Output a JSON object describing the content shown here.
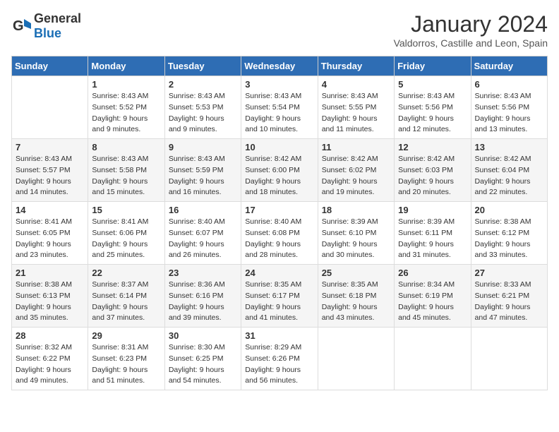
{
  "header": {
    "logo_general": "General",
    "logo_blue": "Blue",
    "month": "January 2024",
    "location": "Valdorros, Castille and Leon, Spain"
  },
  "days_of_week": [
    "Sunday",
    "Monday",
    "Tuesday",
    "Wednesday",
    "Thursday",
    "Friday",
    "Saturday"
  ],
  "weeks": [
    [
      {
        "day": "",
        "info": ""
      },
      {
        "day": "1",
        "info": "Sunrise: 8:43 AM\nSunset: 5:52 PM\nDaylight: 9 hours\nand 9 minutes."
      },
      {
        "day": "2",
        "info": "Sunrise: 8:43 AM\nSunset: 5:53 PM\nDaylight: 9 hours\nand 9 minutes."
      },
      {
        "day": "3",
        "info": "Sunrise: 8:43 AM\nSunset: 5:54 PM\nDaylight: 9 hours\nand 10 minutes."
      },
      {
        "day": "4",
        "info": "Sunrise: 8:43 AM\nSunset: 5:55 PM\nDaylight: 9 hours\nand 11 minutes."
      },
      {
        "day": "5",
        "info": "Sunrise: 8:43 AM\nSunset: 5:56 PM\nDaylight: 9 hours\nand 12 minutes."
      },
      {
        "day": "6",
        "info": "Sunrise: 8:43 AM\nSunset: 5:56 PM\nDaylight: 9 hours\nand 13 minutes."
      }
    ],
    [
      {
        "day": "7",
        "info": "Sunrise: 8:43 AM\nSunset: 5:57 PM\nDaylight: 9 hours\nand 14 minutes."
      },
      {
        "day": "8",
        "info": "Sunrise: 8:43 AM\nSunset: 5:58 PM\nDaylight: 9 hours\nand 15 minutes."
      },
      {
        "day": "9",
        "info": "Sunrise: 8:43 AM\nSunset: 5:59 PM\nDaylight: 9 hours\nand 16 minutes."
      },
      {
        "day": "10",
        "info": "Sunrise: 8:42 AM\nSunset: 6:00 PM\nDaylight: 9 hours\nand 18 minutes."
      },
      {
        "day": "11",
        "info": "Sunrise: 8:42 AM\nSunset: 6:02 PM\nDaylight: 9 hours\nand 19 minutes."
      },
      {
        "day": "12",
        "info": "Sunrise: 8:42 AM\nSunset: 6:03 PM\nDaylight: 9 hours\nand 20 minutes."
      },
      {
        "day": "13",
        "info": "Sunrise: 8:42 AM\nSunset: 6:04 PM\nDaylight: 9 hours\nand 22 minutes."
      }
    ],
    [
      {
        "day": "14",
        "info": "Sunrise: 8:41 AM\nSunset: 6:05 PM\nDaylight: 9 hours\nand 23 minutes."
      },
      {
        "day": "15",
        "info": "Sunrise: 8:41 AM\nSunset: 6:06 PM\nDaylight: 9 hours\nand 25 minutes."
      },
      {
        "day": "16",
        "info": "Sunrise: 8:40 AM\nSunset: 6:07 PM\nDaylight: 9 hours\nand 26 minutes."
      },
      {
        "day": "17",
        "info": "Sunrise: 8:40 AM\nSunset: 6:08 PM\nDaylight: 9 hours\nand 28 minutes."
      },
      {
        "day": "18",
        "info": "Sunrise: 8:39 AM\nSunset: 6:10 PM\nDaylight: 9 hours\nand 30 minutes."
      },
      {
        "day": "19",
        "info": "Sunrise: 8:39 AM\nSunset: 6:11 PM\nDaylight: 9 hours\nand 31 minutes."
      },
      {
        "day": "20",
        "info": "Sunrise: 8:38 AM\nSunset: 6:12 PM\nDaylight: 9 hours\nand 33 minutes."
      }
    ],
    [
      {
        "day": "21",
        "info": "Sunrise: 8:38 AM\nSunset: 6:13 PM\nDaylight: 9 hours\nand 35 minutes."
      },
      {
        "day": "22",
        "info": "Sunrise: 8:37 AM\nSunset: 6:14 PM\nDaylight: 9 hours\nand 37 minutes."
      },
      {
        "day": "23",
        "info": "Sunrise: 8:36 AM\nSunset: 6:16 PM\nDaylight: 9 hours\nand 39 minutes."
      },
      {
        "day": "24",
        "info": "Sunrise: 8:35 AM\nSunset: 6:17 PM\nDaylight: 9 hours\nand 41 minutes."
      },
      {
        "day": "25",
        "info": "Sunrise: 8:35 AM\nSunset: 6:18 PM\nDaylight: 9 hours\nand 43 minutes."
      },
      {
        "day": "26",
        "info": "Sunrise: 8:34 AM\nSunset: 6:19 PM\nDaylight: 9 hours\nand 45 minutes."
      },
      {
        "day": "27",
        "info": "Sunrise: 8:33 AM\nSunset: 6:21 PM\nDaylight: 9 hours\nand 47 minutes."
      }
    ],
    [
      {
        "day": "28",
        "info": "Sunrise: 8:32 AM\nSunset: 6:22 PM\nDaylight: 9 hours\nand 49 minutes."
      },
      {
        "day": "29",
        "info": "Sunrise: 8:31 AM\nSunset: 6:23 PM\nDaylight: 9 hours\nand 51 minutes."
      },
      {
        "day": "30",
        "info": "Sunrise: 8:30 AM\nSunset: 6:25 PM\nDaylight: 9 hours\nand 54 minutes."
      },
      {
        "day": "31",
        "info": "Sunrise: 8:29 AM\nSunset: 6:26 PM\nDaylight: 9 hours\nand 56 minutes."
      },
      {
        "day": "",
        "info": ""
      },
      {
        "day": "",
        "info": ""
      },
      {
        "day": "",
        "info": ""
      }
    ]
  ]
}
